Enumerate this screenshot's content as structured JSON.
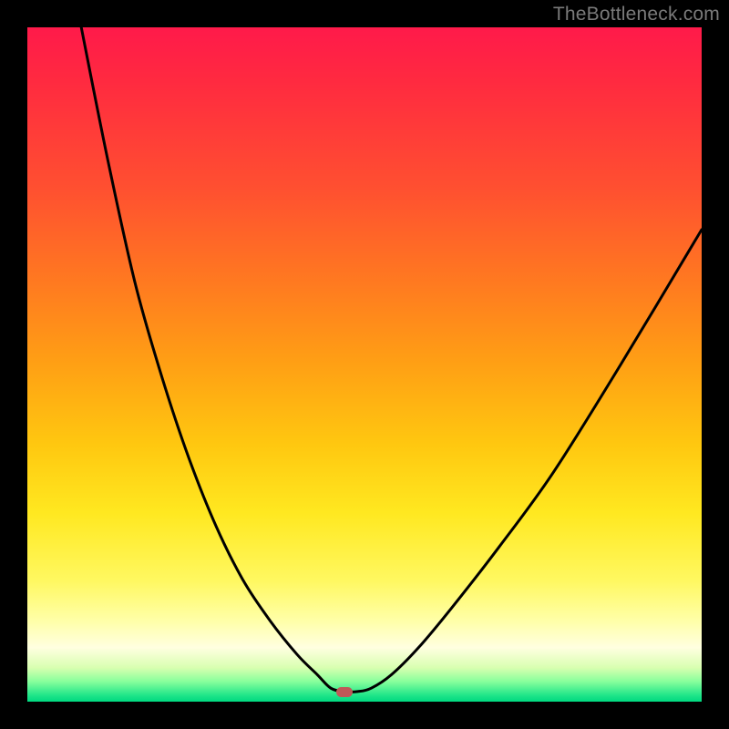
{
  "watermark": "TheBottleneck.com",
  "colors": {
    "frame": "#000000",
    "curve": "#000000",
    "marker": "#c05858",
    "gradient_top": "#ff1a4a",
    "gradient_bottom": "#00d880"
  },
  "chart_data": {
    "type": "line",
    "title": "",
    "xlabel": "",
    "ylabel": "",
    "xlim": [
      0,
      100
    ],
    "ylim": [
      0,
      100
    ],
    "grid": false,
    "legend": false,
    "marker_position": {
      "x_percent": 47,
      "y_percent": 98.5
    },
    "curve_description": "V-shaped curve descending steeply from top-left, reaching a broad minimum near x≈47% at y≈98.5%, then rising concavely toward the right edge reaching roughly y≈30% at x=100%.",
    "series": [
      {
        "name": "curve",
        "x": [
          8,
          12,
          16,
          20,
          24,
          28,
          32,
          36,
          40,
          43,
          45,
          47,
          49,
          51,
          54,
          58,
          63,
          70,
          78,
          88,
          100
        ],
        "y": [
          0,
          20,
          38,
          52,
          64,
          74,
          82,
          88,
          93,
          96,
          98,
          98.5,
          98.5,
          98,
          96,
          92,
          86,
          77,
          66,
          50,
          30
        ]
      }
    ]
  }
}
